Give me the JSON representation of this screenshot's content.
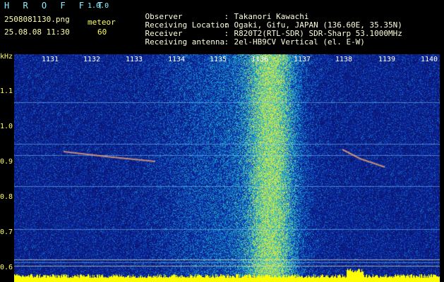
{
  "header": {
    "title": "H R O F F T",
    "version": "1.0.0",
    "filename": "2508081130.png",
    "meteor_label": "meteor",
    "datetime": "25.08.08 11:30",
    "meteor_count": "60"
  },
  "info": [
    {
      "key": "Observer",
      "value": "Takanori Kawachi"
    },
    {
      "key": "Receiving Location",
      "value": "Ogaki, Gifu, JAPAN (136.60E, 35.35N)"
    },
    {
      "key": "Receiver",
      "value": "R820T2(RTL-SDR) SDR-Sharp 53.1000MHz"
    },
    {
      "key": "Receiving antenna",
      "value": "2el-HB9CV Vertical (el. E-W)"
    }
  ],
  "axes": {
    "y_unit": "kHz",
    "y_ticks": [
      "1.1",
      "1.0",
      "0.9",
      "0.8",
      "0.7",
      "0.6"
    ],
    "x_ticks": [
      "1131",
      "1132",
      "1133",
      "1134",
      "1135",
      "1136",
      "1137",
      "1138",
      "1139",
      "1140"
    ]
  },
  "colors": {
    "background": "#000000",
    "spectrum_base": "#1a2fa0",
    "label_yellow": "#ffff66",
    "title_cyan": "#8cf0ff"
  }
}
